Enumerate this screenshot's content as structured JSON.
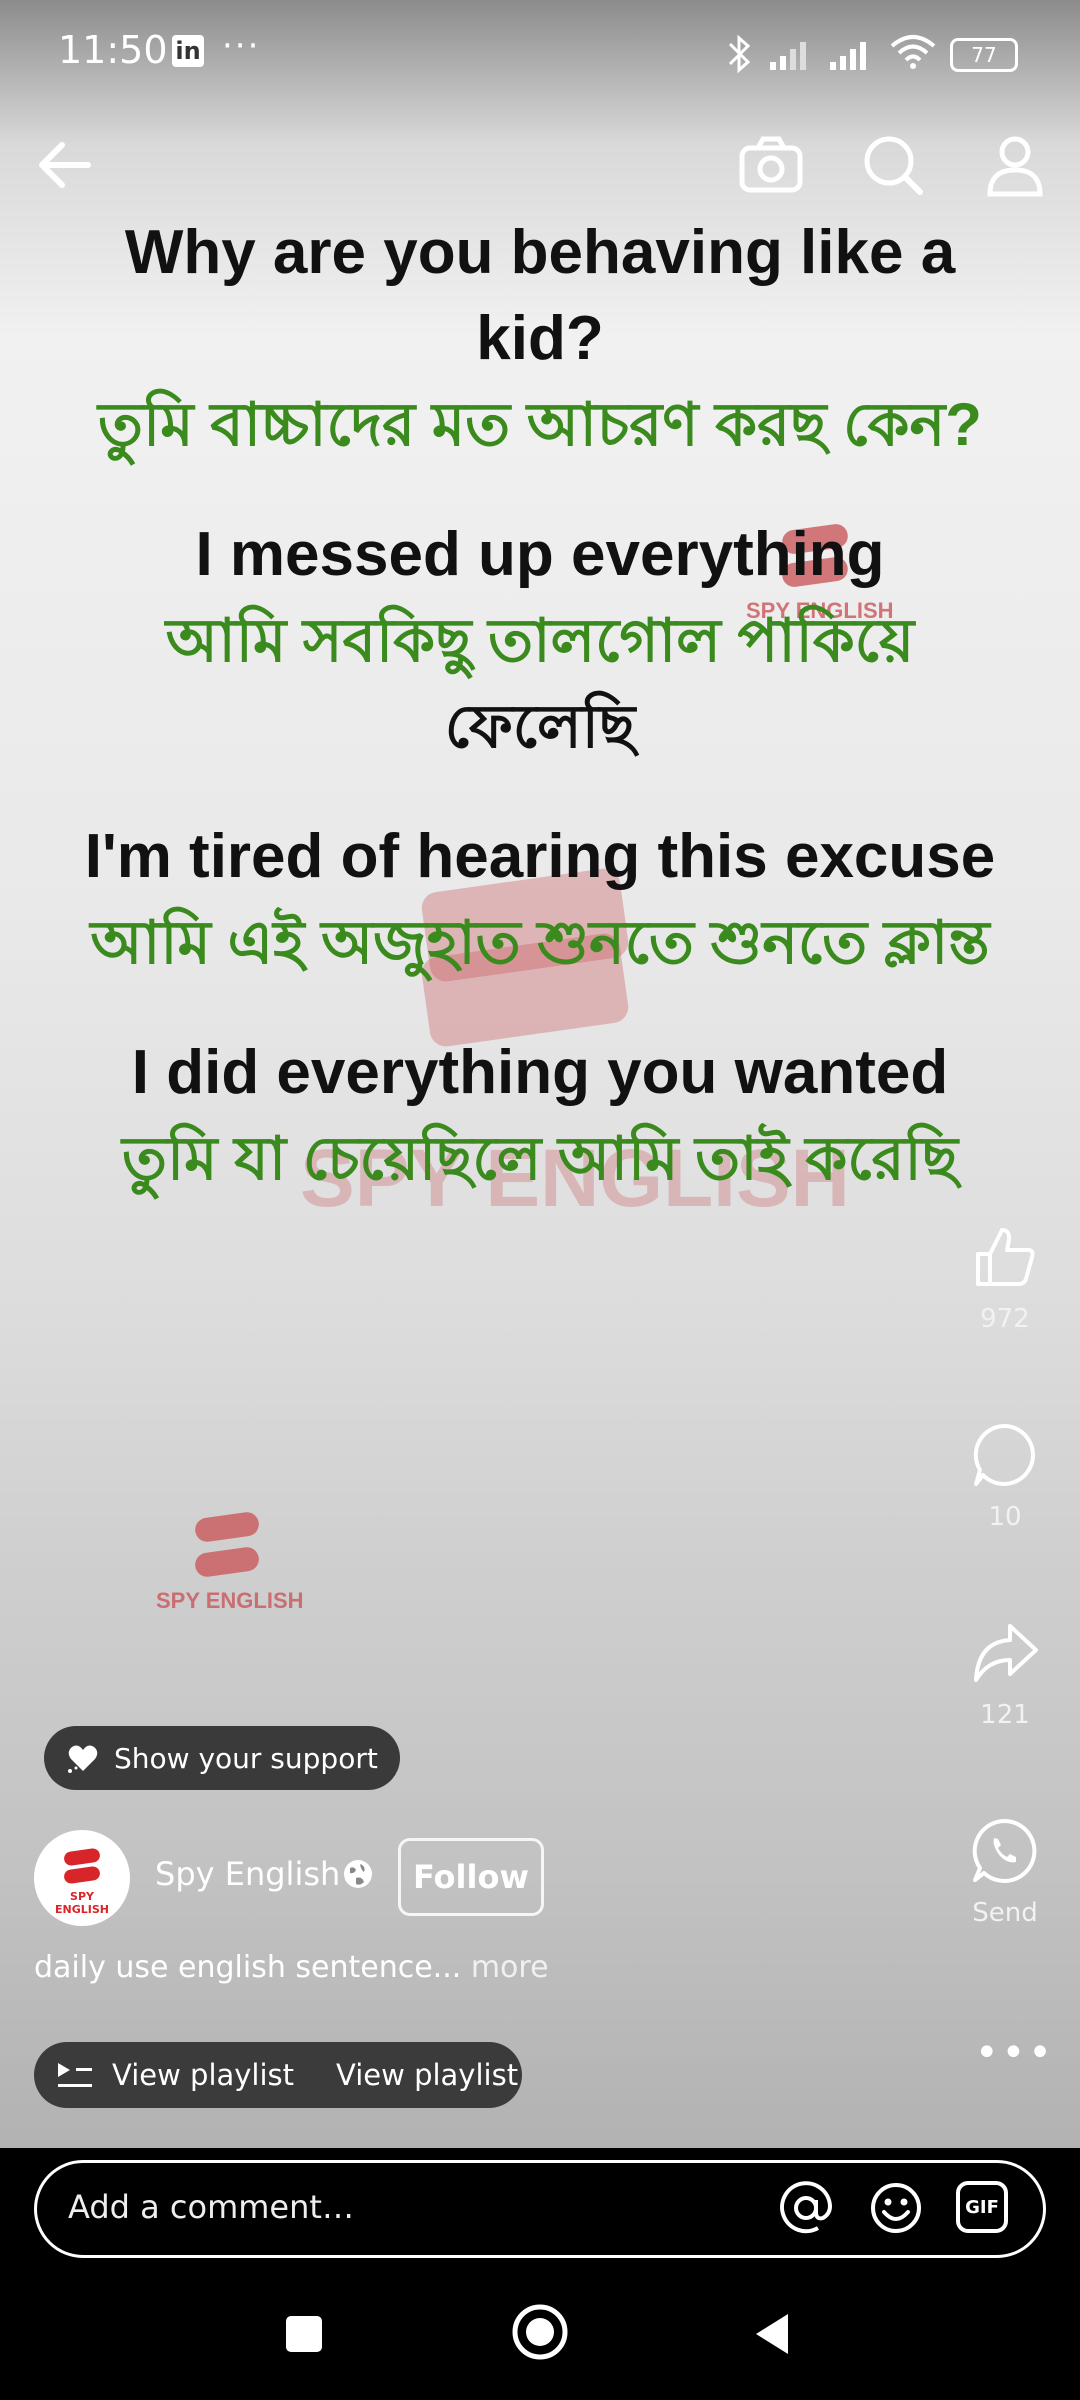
{
  "status_bar": {
    "time": "11:50",
    "linkedin_badge": "in",
    "dots": "···",
    "battery": "77"
  },
  "top_nav": {
    "back_icon": "arrow-left-icon",
    "camera_icon": "camera-icon",
    "search_icon": "search-icon",
    "profile_icon": "person-icon"
  },
  "subtitles": [
    {
      "english": "Why are you behaving like a kid?",
      "bengali": "তুমি বাচ্চাদের মত আচরণ করছ কেন?"
    },
    {
      "english": "I messed up everything",
      "bengali": "আমি সবকিছু তালগোল পাকিয়ে",
      "bengali_2": "ফেলেছি"
    },
    {
      "english": "I'm tired of hearing this excuse",
      "bengali": "আমি এই অজুহাত শুনতে শুনতে ক্লান্ত"
    },
    {
      "english": "I did everything you wanted",
      "bengali": "তুমি যা চেয়েছিলে আমি তাই করেছি"
    }
  ],
  "watermark": {
    "text": "SPY ENGLISH"
  },
  "actions": {
    "like_count": "972",
    "comment_count": "10",
    "share_count": "121",
    "send_label": "Send"
  },
  "support_label": "Show your support",
  "channel": {
    "name": "Spy English",
    "avatar_text": "SPY ENGLISH",
    "follow_label": "Follow"
  },
  "description": {
    "text": "daily use english sentence...",
    "more": "more"
  },
  "playlist": {
    "label_1": "View playlist",
    "label_2": "View playlist"
  },
  "comment_bar": {
    "placeholder": "Add a comment…",
    "gif_label": "GIF"
  }
}
